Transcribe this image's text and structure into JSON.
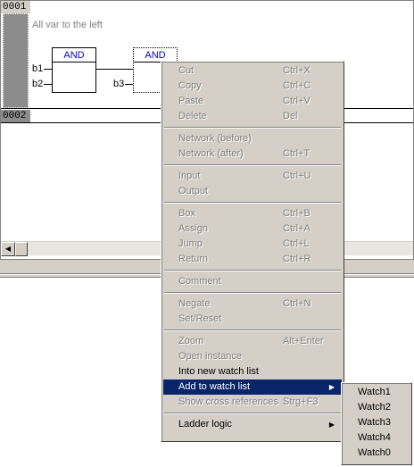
{
  "editor": {
    "networks": [
      {
        "number": "0001",
        "comment": "All var to the left"
      },
      {
        "number": "0002"
      }
    ],
    "blocks": [
      {
        "title": "AND",
        "inputs": [
          "b1",
          "b2"
        ]
      },
      {
        "title": "AND",
        "inputs": [
          "b3"
        ]
      }
    ]
  },
  "context_menu": {
    "items": [
      {
        "label": "Cut",
        "shortcut": "Ctrl+X",
        "enabled": false
      },
      {
        "label": "Copy",
        "shortcut": "Ctrl+C",
        "enabled": false
      },
      {
        "label": "Paste",
        "shortcut": "Ctrl+V",
        "enabled": false
      },
      {
        "label": "Delete",
        "shortcut": "Del",
        "enabled": false
      },
      {
        "label": "Network (before)",
        "shortcut": "",
        "enabled": false
      },
      {
        "label": "Network (after)",
        "shortcut": "Ctrl+T",
        "enabled": false
      },
      {
        "label": "Input",
        "shortcut": "Ctrl+U",
        "enabled": false
      },
      {
        "label": "Output",
        "shortcut": "",
        "enabled": false
      },
      {
        "label": "Box",
        "shortcut": "Ctrl+B",
        "enabled": false
      },
      {
        "label": "Assign",
        "shortcut": "Ctrl+A",
        "enabled": false
      },
      {
        "label": "Jump",
        "shortcut": "Ctrl+L",
        "enabled": false
      },
      {
        "label": "Return",
        "shortcut": "Ctrl+R",
        "enabled": false
      },
      {
        "label": "Comment",
        "shortcut": "",
        "enabled": false
      },
      {
        "label": "Negate",
        "shortcut": "Ctrl+N",
        "enabled": false
      },
      {
        "label": "Set/Reset",
        "shortcut": "",
        "enabled": false
      },
      {
        "label": "Zoom",
        "shortcut": "Alt+Enter",
        "enabled": false
      },
      {
        "label": "Open instance",
        "shortcut": "",
        "enabled": false
      },
      {
        "label": "Into new watch list",
        "shortcut": "",
        "enabled": true
      },
      {
        "label": "Add to watch list",
        "shortcut": "",
        "enabled": true,
        "highlighted": true,
        "submenu": true
      },
      {
        "label": "Show cross references",
        "shortcut": "Strg+F3",
        "enabled": false
      },
      {
        "label": "Ladder logic",
        "shortcut": "",
        "enabled": true,
        "submenu": true
      }
    ]
  },
  "watch_submenu": {
    "items": [
      "Watch1",
      "Watch2",
      "Watch3",
      "Watch4",
      "Watch0"
    ]
  },
  "colors": {
    "menu_bg": "#d4d0c8",
    "highlight": "#0a246a",
    "block_title": "#0000c0",
    "disabled_text": "#808080"
  },
  "icons": {
    "submenu_arrow": "triangle-right-icon",
    "scroll_left": "triangle-left-icon"
  }
}
